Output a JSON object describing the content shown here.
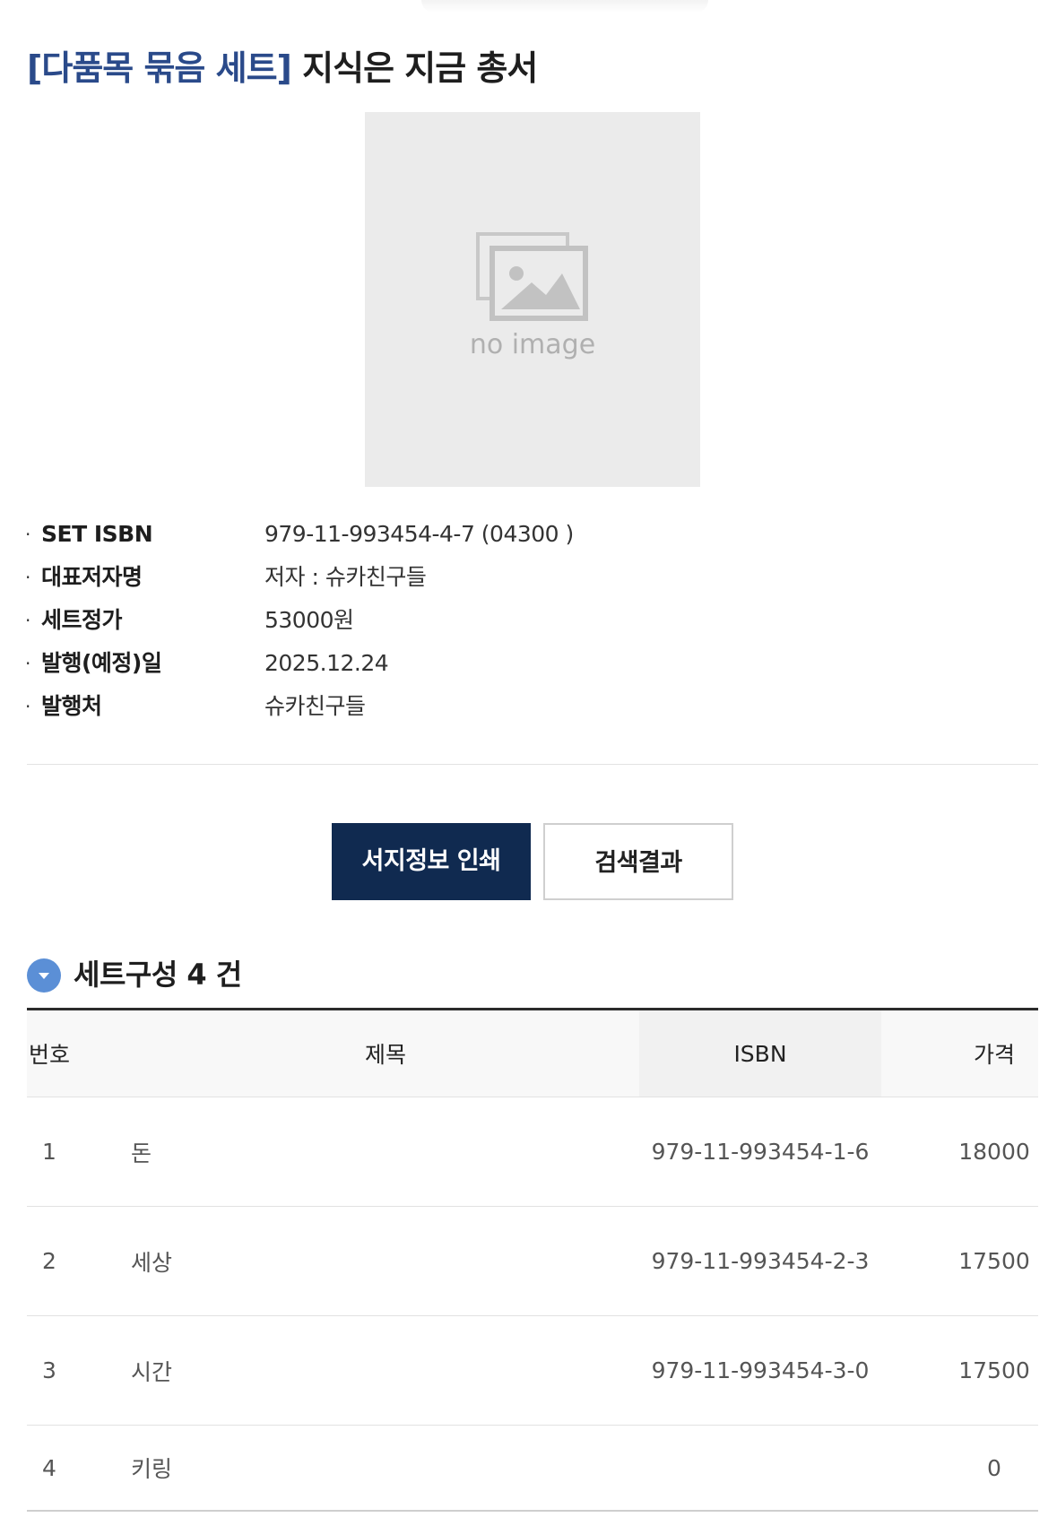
{
  "book": {
    "title_prefix": "[다품목 묶음 세트]",
    "title_main": "지식은 지금 총서",
    "cover_placeholder": "no image"
  },
  "info": [
    {
      "label": "SET ISBN",
      "value": "979-11-993454-4-7 (04300 )"
    },
    {
      "label": "대표저자명",
      "value": "저자 : 슈카친구들"
    },
    {
      "label": "세트정가",
      "value": "53000원"
    },
    {
      "label": "발행(예정)일",
      "value": "2025.12.24"
    },
    {
      "label": "발행처",
      "value": "슈카친구들"
    }
  ],
  "buttons": {
    "print": "서지정보 인쇄",
    "results": "검색결과"
  },
  "set_section": {
    "heading": "세트구성 4 건"
  },
  "table": {
    "headers": {
      "no": "번호",
      "title": "제목",
      "isbn": "ISBN",
      "price": "가격"
    },
    "rows": [
      {
        "no": "1",
        "title": "돈",
        "isbn": "979-11-993454-1-6",
        "price": "18000"
      },
      {
        "no": "2",
        "title": "세상",
        "isbn": "979-11-993454-2-3",
        "price": "17500"
      },
      {
        "no": "3",
        "title": "시간",
        "isbn": "979-11-993454-3-0",
        "price": "17500"
      },
      {
        "no": "4",
        "title": "키링",
        "isbn": "",
        "price": "0"
      }
    ]
  },
  "colors": {
    "title_prefix": "#2a4a8a",
    "primary_button": "#102a50",
    "section_icon": "#5b8fd6"
  },
  "icons": {
    "cover": "image-placeholder-icon",
    "section": "chevron-down-circle-icon"
  }
}
